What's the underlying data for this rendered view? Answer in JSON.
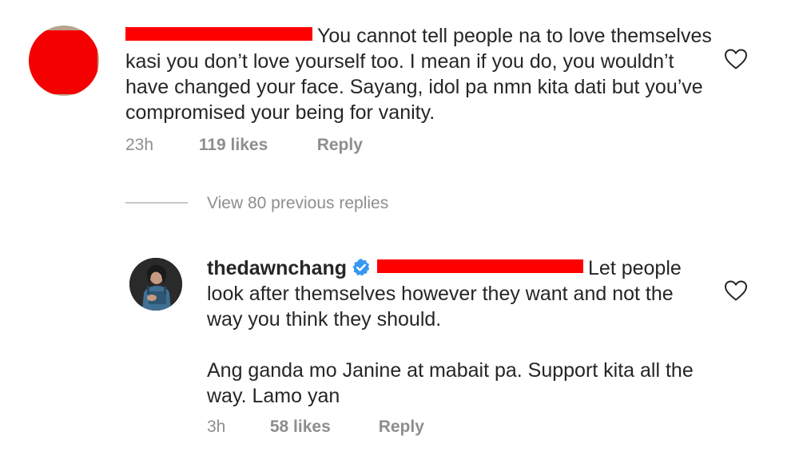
{
  "comment": {
    "avatar_icon": "avatar-icon",
    "username_redacted": true,
    "text": "You cannot  tell people na to love themselves kasi you don’t love yourself too. I mean if you do, you wouldn’t have changed your face. Sayang, idol pa nmn kita dati but you’ve compromised your being for vanity.",
    "time": "23h",
    "likes": "119 likes",
    "reply_label": "Reply"
  },
  "view_replies": "View 80 previous replies",
  "reply": {
    "username": "thedawnchang",
    "verified_icon": "verified-badge-icon",
    "mention_redacted": true,
    "text_part1": "Let people look after themselves however they want and not the way you think they should.",
    "text_part2": "Ang ganda mo Janine at mabait pa. Support kita all the way. Lamo yan",
    "time": "3h",
    "likes": "58 likes",
    "reply_label": "Reply"
  },
  "colors": {
    "text": "#262626",
    "secondary": "#8e8e8e",
    "verified": "#3897f0",
    "redaction": "#ff0000"
  }
}
